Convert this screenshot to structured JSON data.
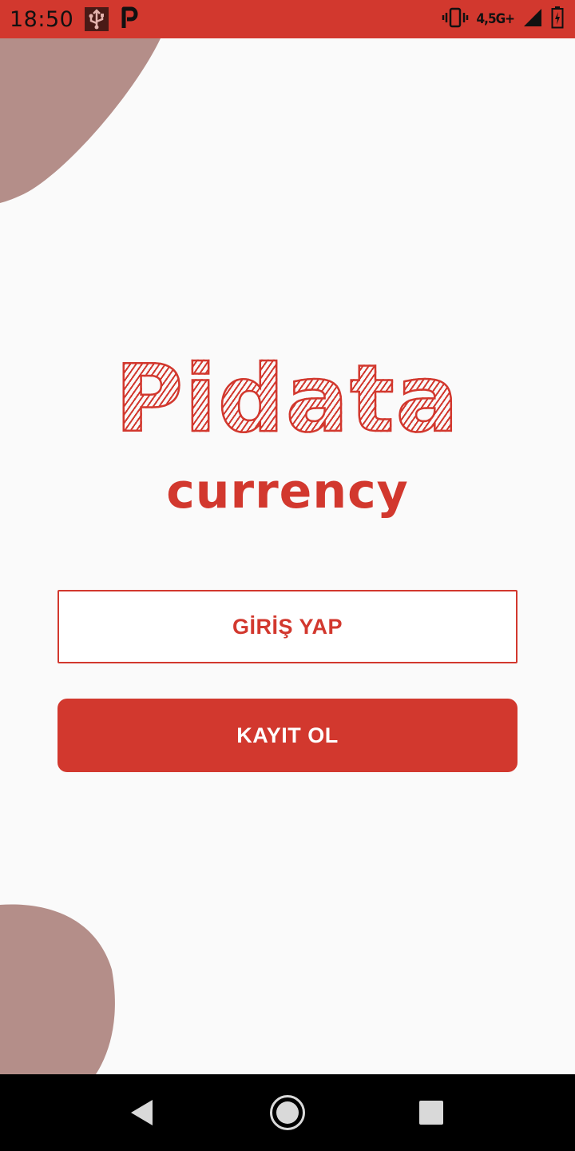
{
  "status_bar": {
    "time": "18:50",
    "network": "4,5G+",
    "icons": [
      "usb-icon",
      "parking-app-icon",
      "vibrate-icon",
      "signal-icon",
      "battery-charging-icon"
    ]
  },
  "logo": {
    "title": "Pidata",
    "subtitle": "currency"
  },
  "buttons": {
    "login_label": "GİRİŞ YAP",
    "register_label": "KAYIT OL"
  },
  "nav_bar": {
    "icons": [
      "back-icon",
      "home-icon",
      "recents-icon"
    ]
  },
  "colors": {
    "brand_red": "#d2382e",
    "background": "#fafafa",
    "blob": "#b48e89",
    "nav_bar": "#000000"
  }
}
